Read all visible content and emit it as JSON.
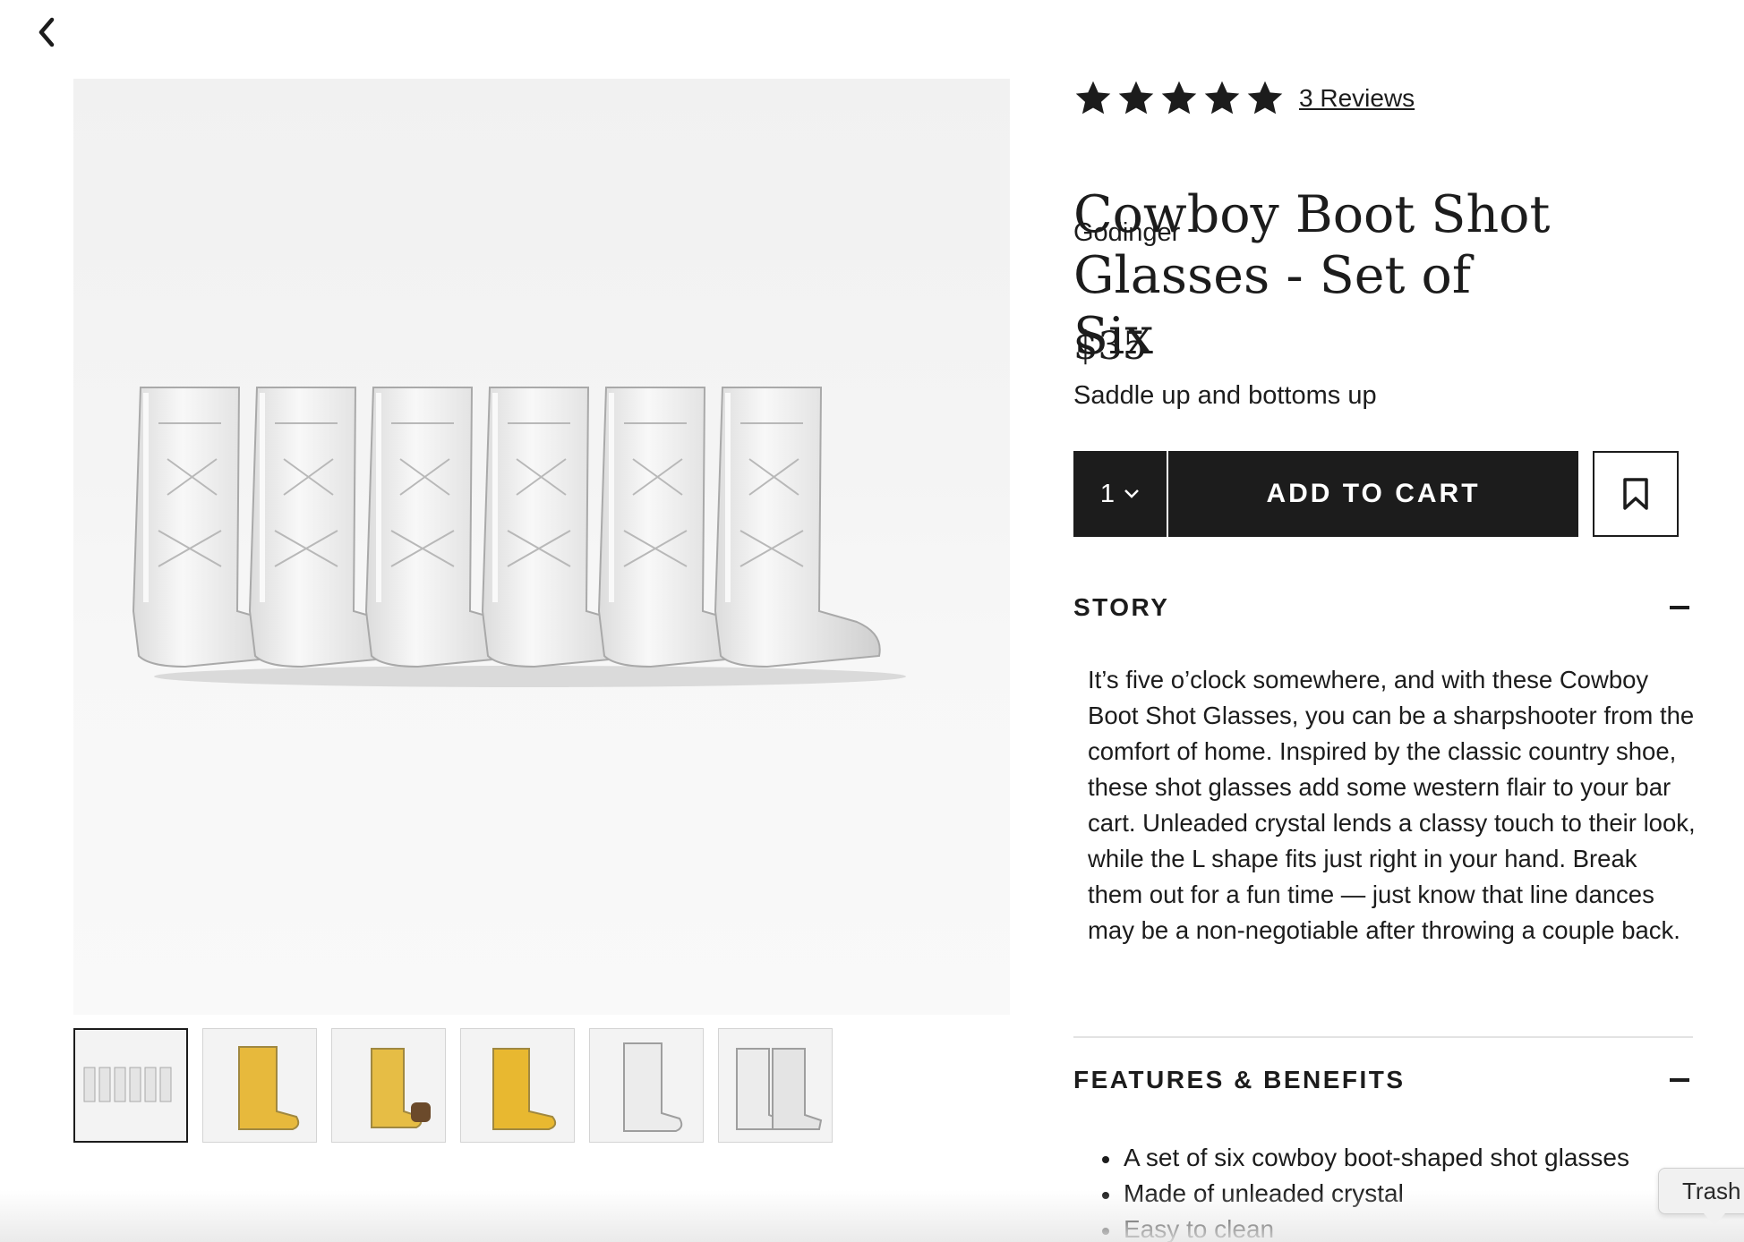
{
  "nav": {
    "back_icon": "chevron-left-icon"
  },
  "product": {
    "rating": {
      "value": 5,
      "max": 5,
      "reviews_label": "3 Reviews"
    },
    "brand": "Godinger",
    "title": "Cowboy Boot Shot Glasses - Set of Six",
    "price": "$35",
    "tagline": "Saddle up and bottoms up"
  },
  "cart": {
    "quantity": "1",
    "add_to_cart_label": "ADD TO CART",
    "save_icon": "bookmark-icon"
  },
  "story": {
    "heading": "STORY",
    "text": "It’s five o’clock somewhere, and with these Cowboy Boot Shot Glasses, you can be a sharpshooter from the comfort of home. Inspired by the classic country shoe, these shot glasses add some western flair to your bar cart. Unleaded crystal lends a classy touch to their look, while the L shape fits just right in your hand. Break them out for a fun time — just know that line dances may be a non-negotiable after throwing a couple back."
  },
  "features": {
    "heading": "FEATURES & BENEFITS",
    "items": [
      "A set of six cowboy boot-shaped shot glasses",
      "Made of unleaded crystal",
      "Easy to clean"
    ]
  },
  "gallery": {
    "thumbnails": [
      {
        "alt": "set-of-six",
        "active": true
      },
      {
        "alt": "filled-boot",
        "active": false
      },
      {
        "alt": "filled-boot-with-cork",
        "active": false
      },
      {
        "alt": "filled-boot-side",
        "active": false
      },
      {
        "alt": "empty-boot",
        "active": false
      },
      {
        "alt": "two-boots",
        "active": false
      }
    ]
  },
  "tooltip": {
    "label": "Trash"
  },
  "colors": {
    "primary": "#1c1c1c",
    "background": "#ffffff",
    "image_bg": "#f4f4f4"
  }
}
